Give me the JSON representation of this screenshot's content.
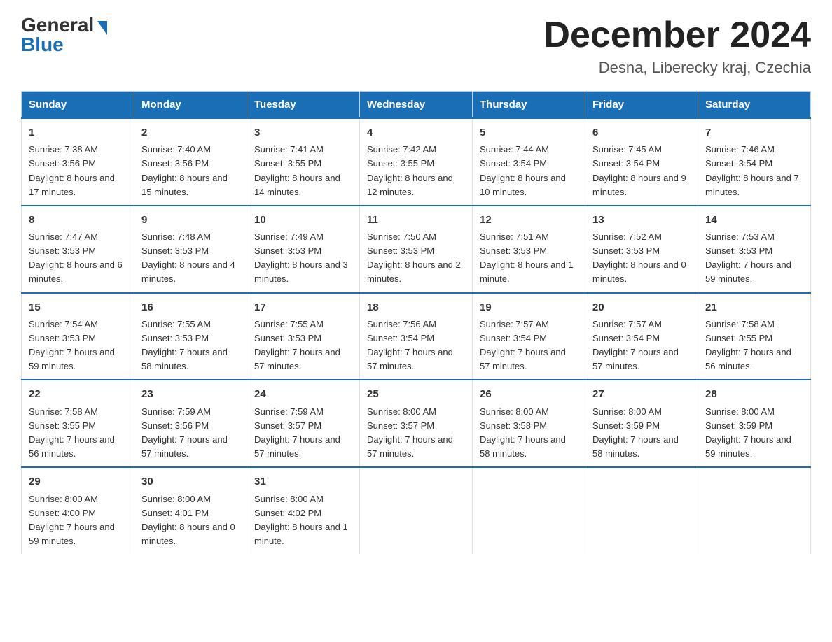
{
  "header": {
    "logo_general": "General",
    "logo_blue": "Blue",
    "title": "December 2024",
    "location": "Desna, Liberecky kraj, Czechia"
  },
  "weekdays": [
    "Sunday",
    "Monday",
    "Tuesday",
    "Wednesday",
    "Thursday",
    "Friday",
    "Saturday"
  ],
  "weeks": [
    [
      {
        "day": "1",
        "sunrise": "7:38 AM",
        "sunset": "3:56 PM",
        "daylight": "8 hours and 17 minutes."
      },
      {
        "day": "2",
        "sunrise": "7:40 AM",
        "sunset": "3:56 PM",
        "daylight": "8 hours and 15 minutes."
      },
      {
        "day": "3",
        "sunrise": "7:41 AM",
        "sunset": "3:55 PM",
        "daylight": "8 hours and 14 minutes."
      },
      {
        "day": "4",
        "sunrise": "7:42 AM",
        "sunset": "3:55 PM",
        "daylight": "8 hours and 12 minutes."
      },
      {
        "day": "5",
        "sunrise": "7:44 AM",
        "sunset": "3:54 PM",
        "daylight": "8 hours and 10 minutes."
      },
      {
        "day": "6",
        "sunrise": "7:45 AM",
        "sunset": "3:54 PM",
        "daylight": "8 hours and 9 minutes."
      },
      {
        "day": "7",
        "sunrise": "7:46 AM",
        "sunset": "3:54 PM",
        "daylight": "8 hours and 7 minutes."
      }
    ],
    [
      {
        "day": "8",
        "sunrise": "7:47 AM",
        "sunset": "3:53 PM",
        "daylight": "8 hours and 6 minutes."
      },
      {
        "day": "9",
        "sunrise": "7:48 AM",
        "sunset": "3:53 PM",
        "daylight": "8 hours and 4 minutes."
      },
      {
        "day": "10",
        "sunrise": "7:49 AM",
        "sunset": "3:53 PM",
        "daylight": "8 hours and 3 minutes."
      },
      {
        "day": "11",
        "sunrise": "7:50 AM",
        "sunset": "3:53 PM",
        "daylight": "8 hours and 2 minutes."
      },
      {
        "day": "12",
        "sunrise": "7:51 AM",
        "sunset": "3:53 PM",
        "daylight": "8 hours and 1 minute."
      },
      {
        "day": "13",
        "sunrise": "7:52 AM",
        "sunset": "3:53 PM",
        "daylight": "8 hours and 0 minutes."
      },
      {
        "day": "14",
        "sunrise": "7:53 AM",
        "sunset": "3:53 PM",
        "daylight": "7 hours and 59 minutes."
      }
    ],
    [
      {
        "day": "15",
        "sunrise": "7:54 AM",
        "sunset": "3:53 PM",
        "daylight": "7 hours and 59 minutes."
      },
      {
        "day": "16",
        "sunrise": "7:55 AM",
        "sunset": "3:53 PM",
        "daylight": "7 hours and 58 minutes."
      },
      {
        "day": "17",
        "sunrise": "7:55 AM",
        "sunset": "3:53 PM",
        "daylight": "7 hours and 57 minutes."
      },
      {
        "day": "18",
        "sunrise": "7:56 AM",
        "sunset": "3:54 PM",
        "daylight": "7 hours and 57 minutes."
      },
      {
        "day": "19",
        "sunrise": "7:57 AM",
        "sunset": "3:54 PM",
        "daylight": "7 hours and 57 minutes."
      },
      {
        "day": "20",
        "sunrise": "7:57 AM",
        "sunset": "3:54 PM",
        "daylight": "7 hours and 57 minutes."
      },
      {
        "day": "21",
        "sunrise": "7:58 AM",
        "sunset": "3:55 PM",
        "daylight": "7 hours and 56 minutes."
      }
    ],
    [
      {
        "day": "22",
        "sunrise": "7:58 AM",
        "sunset": "3:55 PM",
        "daylight": "7 hours and 56 minutes."
      },
      {
        "day": "23",
        "sunrise": "7:59 AM",
        "sunset": "3:56 PM",
        "daylight": "7 hours and 57 minutes."
      },
      {
        "day": "24",
        "sunrise": "7:59 AM",
        "sunset": "3:57 PM",
        "daylight": "7 hours and 57 minutes."
      },
      {
        "day": "25",
        "sunrise": "8:00 AM",
        "sunset": "3:57 PM",
        "daylight": "7 hours and 57 minutes."
      },
      {
        "day": "26",
        "sunrise": "8:00 AM",
        "sunset": "3:58 PM",
        "daylight": "7 hours and 58 minutes."
      },
      {
        "day": "27",
        "sunrise": "8:00 AM",
        "sunset": "3:59 PM",
        "daylight": "7 hours and 58 minutes."
      },
      {
        "day": "28",
        "sunrise": "8:00 AM",
        "sunset": "3:59 PM",
        "daylight": "7 hours and 59 minutes."
      }
    ],
    [
      {
        "day": "29",
        "sunrise": "8:00 AM",
        "sunset": "4:00 PM",
        "daylight": "7 hours and 59 minutes."
      },
      {
        "day": "30",
        "sunrise": "8:00 AM",
        "sunset": "4:01 PM",
        "daylight": "8 hours and 0 minutes."
      },
      {
        "day": "31",
        "sunrise": "8:00 AM",
        "sunset": "4:02 PM",
        "daylight": "8 hours and 1 minute."
      },
      null,
      null,
      null,
      null
    ]
  ]
}
